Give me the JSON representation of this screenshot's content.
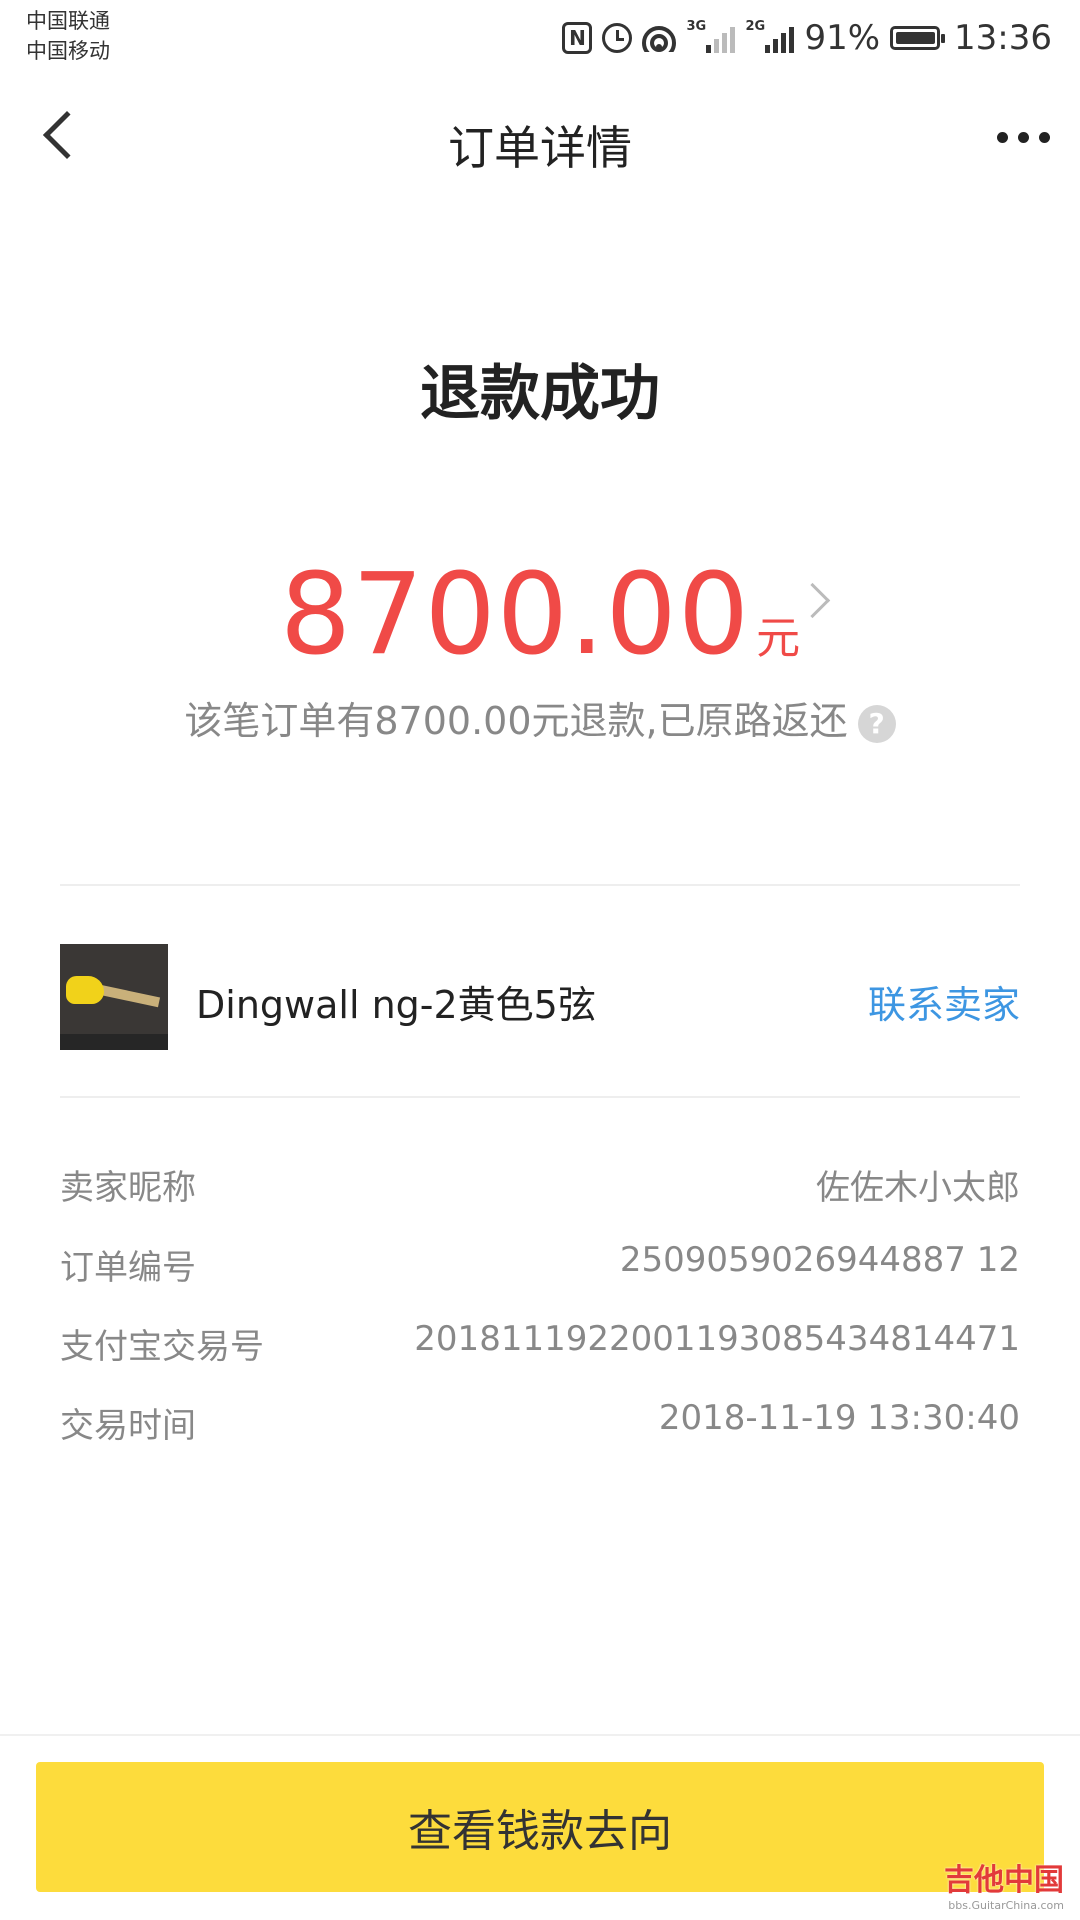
{
  "status_bar": {
    "carrier_1": "中国联通",
    "carrier_2": "中国移动",
    "net_1": "3G",
    "net_2": "2G",
    "battery": "91%",
    "time": "13:36"
  },
  "nav": {
    "title": "订单详情"
  },
  "refund": {
    "status": "退款成功",
    "amount": "8700.00",
    "unit": "元",
    "note": "该笔订单有8700.00元退款,已原路返还"
  },
  "product": {
    "name": "Dingwall ng-2黄色5弦",
    "contact_label": "联系卖家"
  },
  "details": [
    {
      "label": "卖家昵称",
      "value": "佐佐木小太郎"
    },
    {
      "label": "订单编号",
      "value": "2509059026944887 12"
    },
    {
      "label": "支付宝交易号",
      "value": "2018111922001193085434814471"
    },
    {
      "label": "交易时间",
      "value": "2018-11-19 13:30:40"
    }
  ],
  "action": {
    "label": "查看钱款去向"
  },
  "watermark": {
    "text": "吉他中国",
    "sub": "bbs.GuitarChina.com"
  },
  "colors": {
    "accent_red": "#f04a47",
    "link_blue": "#3d96e2",
    "button_yellow": "#fddc3c"
  }
}
